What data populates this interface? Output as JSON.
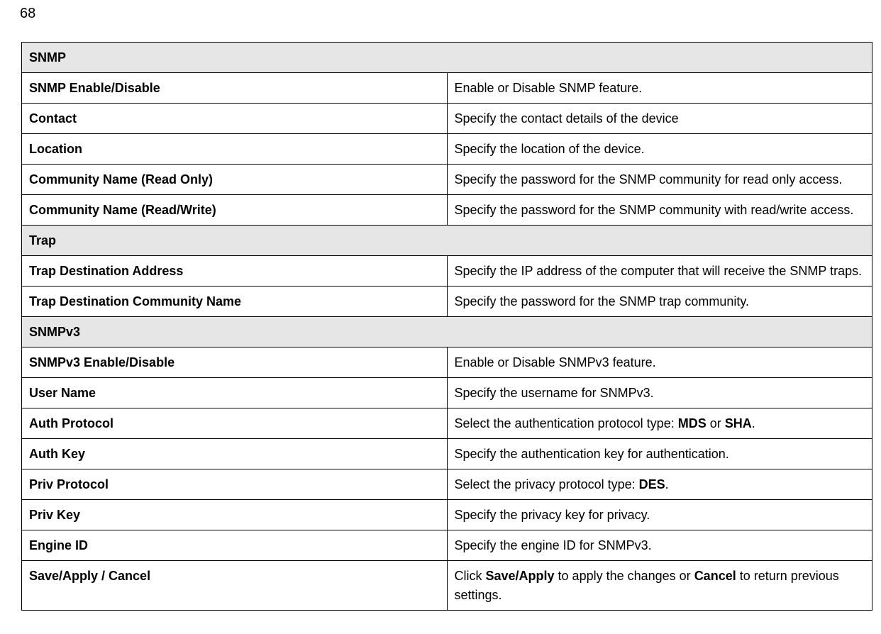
{
  "page_number": "68",
  "sections": {
    "snmp": {
      "header": "SNMP",
      "rows": [
        {
          "label": "SNMP Enable/Disable",
          "desc_parts": [
            {
              "text": "Enable or Disable SNMP feature.",
              "bold": false
            }
          ]
        },
        {
          "label": "Contact",
          "desc_parts": [
            {
              "text": "Specify the contact details of the device",
              "bold": false
            }
          ]
        },
        {
          "label": "Location",
          "desc_parts": [
            {
              "text": "Specify the location of the device.",
              "bold": false
            }
          ]
        },
        {
          "label": "Community Name (Read Only)",
          "desc_parts": [
            {
              "text": "Specify the password for the SNMP community for read only access.",
              "bold": false
            }
          ]
        },
        {
          "label": "Community Name (Read/Write)",
          "desc_parts": [
            {
              "text": "Specify the password for the SNMP community with read/write access.",
              "bold": false
            }
          ]
        }
      ]
    },
    "trap": {
      "header": "Trap",
      "rows": [
        {
          "label": "Trap Destination Address",
          "desc_parts": [
            {
              "text": "Specify the IP address of the computer that will receive the SNMP traps.",
              "bold": false
            }
          ]
        },
        {
          "label": "Trap Destination Community Name",
          "desc_parts": [
            {
              "text": "Specify the password for the SNMP trap community.",
              "bold": false
            }
          ]
        }
      ]
    },
    "snmpv3": {
      "header": "SNMPv3",
      "rows": [
        {
          "label": "SNMPv3 Enable/Disable",
          "desc_parts": [
            {
              "text": "Enable or Disable SNMPv3 feature.",
              "bold": false
            }
          ]
        },
        {
          "label": "User Name",
          "desc_parts": [
            {
              "text": "Specify the username for SNMPv3.",
              "bold": false
            }
          ]
        },
        {
          "label": "Auth Protocol",
          "desc_parts": [
            {
              "text": "Select the authentication protocol type: ",
              "bold": false
            },
            {
              "text": "MDS",
              "bold": true
            },
            {
              "text": " or ",
              "bold": false
            },
            {
              "text": "SHA",
              "bold": true
            },
            {
              "text": ".",
              "bold": false
            }
          ]
        },
        {
          "label": "Auth Key",
          "desc_parts": [
            {
              "text": "Specify the authentication key for authentication.",
              "bold": false
            }
          ]
        },
        {
          "label": "Priv Protocol",
          "desc_parts": [
            {
              "text": "Select the privacy protocol type: ",
              "bold": false
            },
            {
              "text": "DES",
              "bold": true
            },
            {
              "text": ".",
              "bold": false
            }
          ]
        },
        {
          "label": "Priv Key",
          "desc_parts": [
            {
              "text": "Specify the privacy key for privacy.",
              "bold": false
            }
          ]
        },
        {
          "label": "Engine ID",
          "desc_parts": [
            {
              "text": "Specify the engine ID for SNMPv3.",
              "bold": false
            }
          ]
        },
        {
          "label": "Save/Apply / Cancel",
          "desc_parts": [
            {
              "text": "Click ",
              "bold": false
            },
            {
              "text": "Save/Apply",
              "bold": true
            },
            {
              "text": " to apply the changes or ",
              "bold": false
            },
            {
              "text": "Cancel",
              "bold": true
            },
            {
              "text": " to return previous settings.",
              "bold": false
            }
          ]
        }
      ]
    }
  }
}
